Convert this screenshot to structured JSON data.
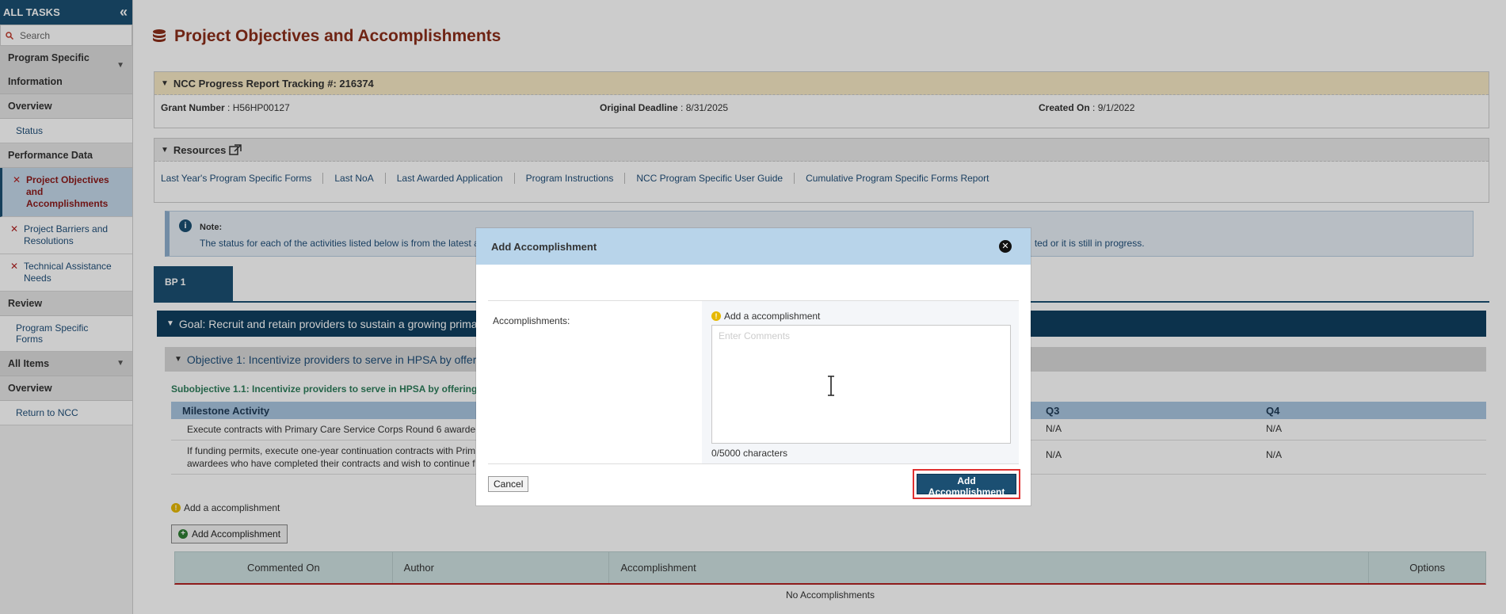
{
  "sidebar": {
    "title": "ALL TASKS",
    "search_placeholder": "Search",
    "groups": [
      {
        "label": "Program Specific Information"
      },
      {
        "label": "Overview"
      },
      {
        "label": "Status"
      },
      {
        "label": "Performance Data"
      },
      {
        "label": "Project Objectives and Accomplishments"
      },
      {
        "label": "Project Barriers and Resolutions"
      },
      {
        "label": "Technical Assistance Needs"
      },
      {
        "label": "Review"
      },
      {
        "label": "Program Specific Forms"
      },
      {
        "label": "All Items"
      },
      {
        "label": "Overview"
      },
      {
        "label": "Return to NCC"
      }
    ]
  },
  "page": {
    "title": "Project Objectives and Accomplishments"
  },
  "tracking": {
    "title": "NCC Progress Report Tracking #: 216374",
    "grant_label": "Grant Number",
    "grant_value": " : H56HP00127",
    "deadline_label": "Original Deadline",
    "deadline_value": " : 8/31/2025",
    "created_label": "Created On",
    "created_value": " : 9/1/2022"
  },
  "resources": {
    "title": "Resources",
    "links": [
      "Last Year's Program Specific Forms",
      "Last NoA",
      "Last Awarded Application",
      "Program Instructions",
      "NCC Program Specific User Guide",
      "Cumulative Program Specific Forms Report"
    ]
  },
  "note": {
    "title": "Note:",
    "text_left": "The status for each of the activities listed below is from the latest a",
    "text_right": "ted or it is still in progress."
  },
  "tabs": {
    "bp1": "BP 1"
  },
  "goal": {
    "title": "Goal: Recruit and retain providers to sustain a growing primar"
  },
  "objective": {
    "title": "Objective 1: Incentivize providers to serve in HPSA by offerin"
  },
  "subobjective": {
    "title": "Subobjective 1.1: Incentivize providers to serve in HPSA by offering"
  },
  "milestones": {
    "headers": {
      "activity": "Milestone Activity",
      "q3": "Q3",
      "q4": "Q4"
    },
    "rows": [
      {
        "activity_l1": "Execute contracts with Primary Care Service Corps Round 6 awarde",
        "activity_l2": "",
        "q3": "N/A",
        "q4": "N/A"
      },
      {
        "activity_l1": "If funding permits, execute one-year continuation contracts with Prim",
        "activity_l2": "awardees who have completed their contracts and wish to continue f",
        "q3": "N/A",
        "q4": "N/A"
      }
    ]
  },
  "accomplishments": {
    "hint": "Add a accomplishment",
    "add_button": "Add Accomplishment",
    "headers": {
      "commented_on": "Commented On",
      "author": "Author",
      "accomplishment": "Accomplishment",
      "options": "Options"
    },
    "empty": "No Accomplishments"
  },
  "modal": {
    "title": "Add Accomplishment",
    "field_label": "Accomplishments:",
    "hint": "Add a accomplishment",
    "placeholder": "Enter Comments",
    "counter": "0/5000 characters",
    "cancel": "Cancel",
    "submit": "Add Accomplishment"
  }
}
